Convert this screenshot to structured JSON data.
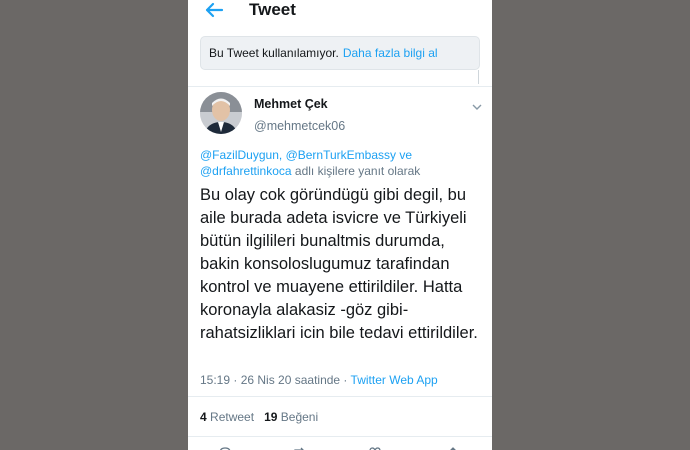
{
  "header": {
    "title": "Tweet",
    "back_icon": "arrow-left-icon",
    "accent": "#1da1f2"
  },
  "notice": {
    "text": "Bu Tweet kullanılamıyor.",
    "link": "Daha fazla bilgi al"
  },
  "tweet": {
    "author_name": "Mehmet Çek",
    "author_handle": "@mehmetcek06",
    "reply_mentions_line1_a": "@FazilDuygun",
    "reply_sep1": ", ",
    "reply_mentions_line1_b": "@BernTurkEmbassy",
    "reply_and": " ve",
    "reply_mentions_line2": "@drfahrettinkoca",
    "reply_suffix": " adlı kişilere yanıt olarak",
    "text": "Bu olay cok göründügü gibi degil, bu aile burada adeta isvicre ve Türkiyeli bütün ilgilileri bunaltmis durumda, bakin konsoloslugumuz tarafindan kontrol ve muayene ettirildiler. Hatta koronayla alakasiz -göz gibi- rahatsizliklari icin bile tedavi ettirildiler.",
    "timestamp": "15:19 · 26 Nis 20 saatinde · ",
    "source": "Twitter Web App",
    "retweet_count": "4",
    "retweet_label": "Retweet",
    "like_count": "19",
    "like_label": "Beğeni"
  },
  "icons": {
    "more": "chevron-down-icon",
    "actions": [
      "reply-icon",
      "retweet-icon",
      "like-icon",
      "share-icon"
    ]
  }
}
